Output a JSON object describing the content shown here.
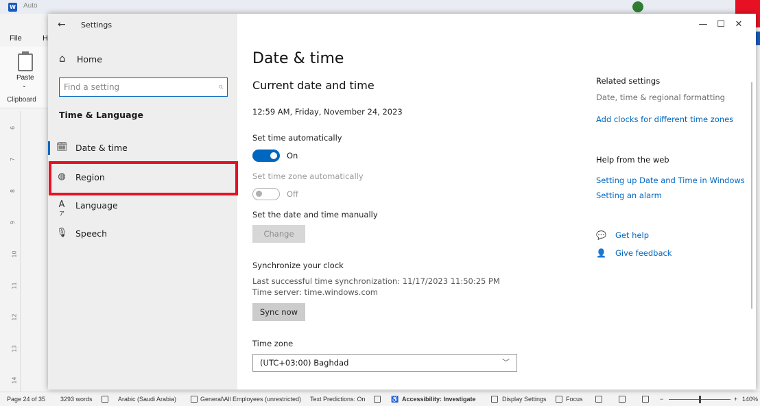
{
  "word": {
    "autosave_label": "Auto",
    "tab_file": "File",
    "tab_home_partial": "H",
    "paste_label": "Paste",
    "clipboard_label": "Clipboard",
    "ruler_marks": [
      "6",
      "7",
      "8",
      "9",
      "10",
      "11",
      "12",
      "13",
      "14"
    ]
  },
  "statusbar": {
    "page": "Page 24 of 35",
    "words": "3293 words",
    "language": "Arabic (Saudi Arabia)",
    "sensitivity": "General\\All Employees (unrestricted)",
    "text_predictions": "Text Predictions: On",
    "accessibility": "Accessibility: Investigate",
    "display_settings": "Display Settings",
    "focus": "Focus",
    "zoom_minus": "−",
    "zoom_plus": "+",
    "zoom": "140%",
    "zoom_level_percent": 140
  },
  "settings": {
    "window_title": "Settings",
    "back_glyph": "←",
    "window_controls": {
      "minimize": "—",
      "maximize": "☐",
      "close": "✕"
    },
    "nav": {
      "home_label": "Home",
      "search_placeholder": "Find a setting",
      "section_title": "Time & Language",
      "items": [
        {
          "label": "Date & time",
          "icon": "calendar-clock-icon",
          "selected": true
        },
        {
          "label": "Region",
          "icon": "globe-icon",
          "selected": false
        },
        {
          "label": "Language",
          "icon": "language-icon",
          "selected": false
        },
        {
          "label": "Speech",
          "icon": "microphone-icon",
          "selected": false
        }
      ]
    },
    "main": {
      "title": "Date & time",
      "subtitle": "Current date and time",
      "current_datetime": "12:59 AM, Friday, November 24, 2023",
      "set_time_auto": {
        "label": "Set time automatically",
        "state": "On",
        "enabled": true
      },
      "set_timezone_auto": {
        "label": "Set time zone automatically",
        "state": "Off",
        "enabled": false
      },
      "manual": {
        "label": "Set the date and time manually",
        "button": "Change"
      },
      "sync": {
        "title": "Synchronize your clock",
        "last_sync": "Last successful time synchronization: 11/17/2023 11:50:25 PM",
        "server": "Time server: time.windows.com",
        "button": "Sync now"
      },
      "timezone": {
        "label": "Time zone",
        "value": "(UTC+03:00) Baghdad"
      }
    },
    "related": {
      "title": "Related settings",
      "subtitle": "Date, time & regional formatting",
      "link": "Add clocks for different time zones"
    },
    "help": {
      "title": "Help from the web",
      "links": [
        "Setting up Date and Time in Windows",
        "Setting an alarm"
      ],
      "get_help": "Get help",
      "give_feedback": "Give feedback"
    }
  },
  "colors": {
    "accent": "#0067c0",
    "highlight": "#e81123",
    "nav_bg": "#eeeeee"
  }
}
